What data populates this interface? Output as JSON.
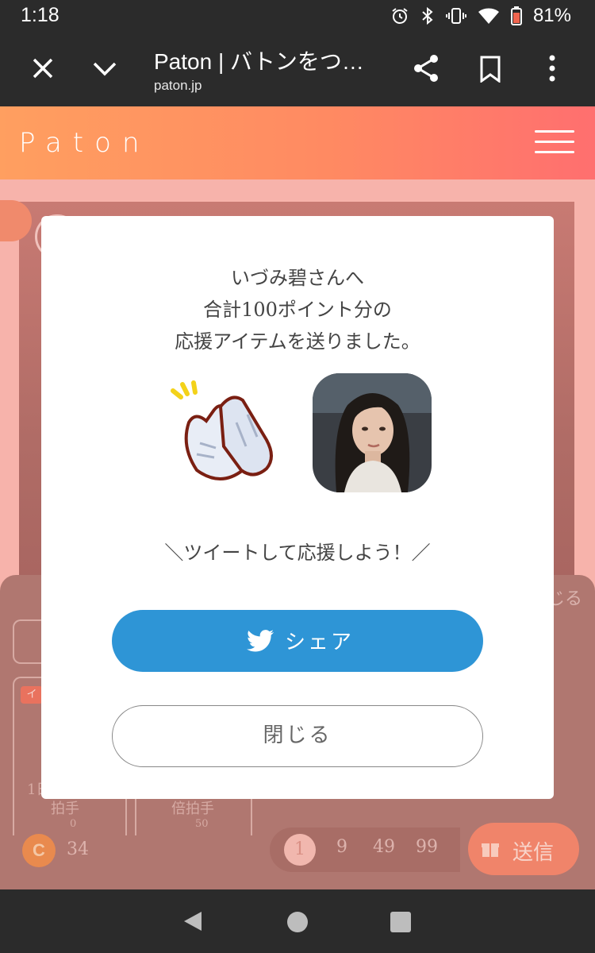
{
  "status_bar": {
    "time": "1:18",
    "battery": "81%",
    "icons": [
      "alarm-icon",
      "bluetooth-icon",
      "vibrate-icon",
      "wifi-icon",
      "battery-icon"
    ]
  },
  "browser": {
    "title": "Paton | バトンをつ…",
    "url": "paton.jp"
  },
  "site": {
    "logo": "Paton",
    "brand_color_start": "#ff9f60",
    "brand_color_end": "#ff6f6f"
  },
  "background": {
    "close_text": "じる",
    "badge": "イ",
    "card1_line1": "1日",
    "card1_line2": "拍手",
    "card1_price": "0",
    "card2_line2": "倍拍手",
    "card2_price": "50",
    "coin_symbol": "C",
    "coin_balance": "34",
    "quantities": [
      "1",
      "9",
      "49",
      "99"
    ],
    "send_label": "送信"
  },
  "modal": {
    "message_line1": "いづみ碧さんへ",
    "message_line2": "合計100ポイント分の",
    "message_line3": "応援アイテムを送りました。",
    "tweet_prompt": "＼ツイートして応援しよう！／",
    "share_label": "シェア",
    "close_label": "閉じる",
    "share_color": "#2e95d6"
  }
}
